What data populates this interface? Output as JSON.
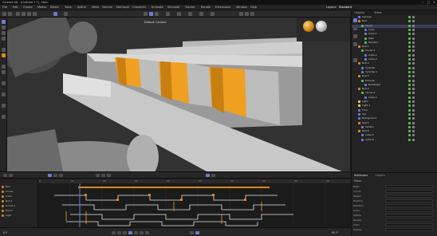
{
  "app": {
    "title": "Cinema 4D - [Untitled 1 *] - Main",
    "colors": {
      "accent": "#6d7bd6",
      "orange": "#f0a020",
      "bg": "#1a1a1a",
      "panel": "#232323"
    }
  },
  "menubar": {
    "items": [
      "File",
      "Edit",
      "Create",
      "Modes",
      "Select",
      "Tools",
      "Spline",
      "Mesh",
      "Volume",
      "MoGraph",
      "Character",
      "Animate",
      "Simulate",
      "Tracker",
      "Render",
      "Extensions",
      "Window",
      "Help"
    ],
    "layout_label": "Layout:",
    "layout_value": "Standard"
  },
  "viewport": {
    "label": "Perspective",
    "camera_label": "Default Camera"
  },
  "right_panel": {
    "tabs": [
      "Objects",
      "Takes"
    ],
    "tree_rows": [
      {
        "label": "Camera",
        "icon_color": "#6d7bd6",
        "indent": 8
      },
      {
        "label": "Null",
        "icon_color": "#d98a1a",
        "indent": 8
      },
      {
        "label": "Cloner",
        "icon_color": "#5bbd4b",
        "indent": 12
      },
      {
        "label": "Cube",
        "icon_color": "#6d7bd6",
        "indent": 16
      },
      {
        "label": "Cube.1",
        "icon_color": "#6d7bd6",
        "indent": 16
      },
      {
        "label": "Plain",
        "icon_color": "#5bbd4b",
        "indent": 16
      },
      {
        "label": "Random",
        "icon_color": "#5bbd4b",
        "indent": 16
      },
      {
        "label": "Null.1",
        "icon_color": "#d98a1a",
        "indent": 8
      },
      {
        "label": "Cloner.1",
        "icon_color": "#5bbd4b",
        "indent": 12
      },
      {
        "label": "Cube.2",
        "icon_color": "#6d7bd6",
        "indent": 16
      },
      {
        "label": "Cube.3",
        "icon_color": "#6d7bd6",
        "indent": 16
      },
      {
        "label": "Null.2",
        "icon_color": "#d98a1a",
        "indent": 8
      },
      {
        "label": "Cylinder",
        "icon_color": "#6d7bd6",
        "indent": 12
      },
      {
        "label": "Cylinder.1",
        "icon_color": "#6d7bd6",
        "indent": 12
      },
      {
        "label": "Null.3",
        "icon_color": "#d98a1a",
        "indent": 8
      },
      {
        "label": "Extrude",
        "icon_color": "#5bbd4b",
        "indent": 12
      },
      {
        "label": "Rectangle",
        "icon_color": "#6d7bd6",
        "indent": 16
      },
      {
        "label": "Null.4",
        "icon_color": "#d98a1a",
        "indent": 8
      },
      {
        "label": "Cloner.2",
        "icon_color": "#5bbd4b",
        "indent": 12
      },
      {
        "label": "Cube.4",
        "icon_color": "#6d7bd6",
        "indent": 16
      },
      {
        "label": "Light",
        "icon_color": "#f0d040",
        "indent": 8
      },
      {
        "label": "Light.1",
        "icon_color": "#f0d040",
        "indent": 8
      },
      {
        "label": "Floor",
        "icon_color": "#6d7bd6",
        "indent": 8
      },
      {
        "label": "Sky",
        "icon_color": "#6d7bd6",
        "indent": 8
      },
      {
        "label": "Background",
        "icon_color": "#6d7bd6",
        "indent": 8
      },
      {
        "label": "Null.5",
        "icon_color": "#d98a1a",
        "indent": 8
      },
      {
        "label": "Sphere",
        "icon_color": "#6d7bd6",
        "indent": 12
      },
      {
        "label": "Null.6",
        "icon_color": "#d98a1a",
        "indent": 8
      },
      {
        "label": "Cube.5",
        "icon_color": "#6d7bd6",
        "indent": 12
      },
      {
        "label": "Cube.6",
        "icon_color": "#6d7bd6",
        "indent": 12
      }
    ]
  },
  "timeline": {
    "tracks": [
      {
        "label": "Null"
      },
      {
        "label": "Cloner"
      },
      {
        "label": "Cube"
      },
      {
        "label": "Null.1"
      },
      {
        "label": "Cloner.1"
      },
      {
        "label": "Null.2"
      },
      {
        "label": "Light"
      }
    ],
    "ruler_labels": [
      "0",
      "10",
      "20",
      "30",
      "40",
      "50",
      "60",
      "70",
      "80",
      "90"
    ],
    "current_frame": "0 F",
    "end_frame": "90 F"
  },
  "attributes": {
    "tabs": [
      "Attributes",
      "Layers"
    ],
    "mode_label": "Mode",
    "rows": [
      {
        "label": "Basic"
      },
      {
        "label": "Coord."
      },
      {
        "label": "Object"
      },
      {
        "label": "Position"
      },
      {
        "label": "Rotation"
      },
      {
        "label": "Scale"
      },
      {
        "label": "Visible"
      },
      {
        "label": "Render"
      },
      {
        "label": "Color"
      },
      {
        "label": "Display"
      }
    ]
  }
}
